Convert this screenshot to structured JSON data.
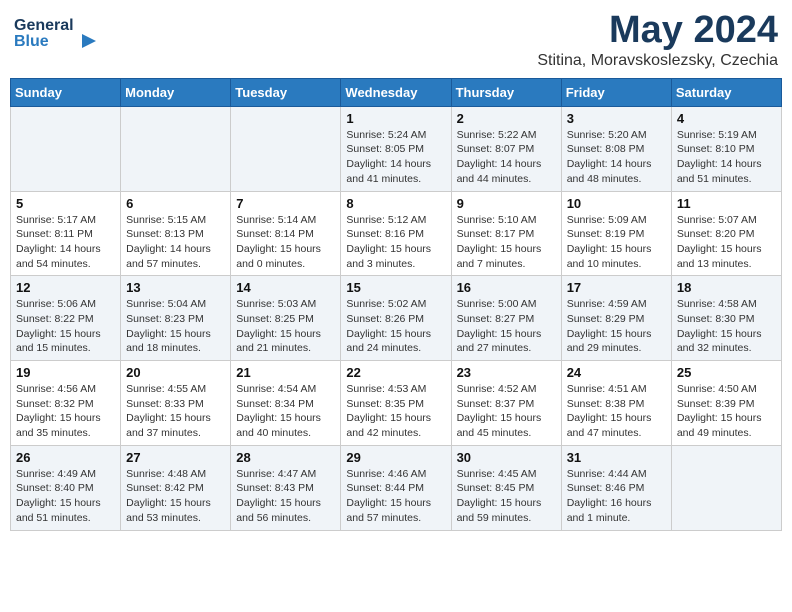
{
  "header": {
    "logo_general": "General",
    "logo_blue": "Blue",
    "title": "May 2024",
    "subtitle": "Stitina, Moravskoslezsky, Czechia"
  },
  "days_of_week": [
    "Sunday",
    "Monday",
    "Tuesday",
    "Wednesday",
    "Thursday",
    "Friday",
    "Saturday"
  ],
  "weeks": [
    [
      {
        "day": "",
        "info": ""
      },
      {
        "day": "",
        "info": ""
      },
      {
        "day": "",
        "info": ""
      },
      {
        "day": "1",
        "info": "Sunrise: 5:24 AM\nSunset: 8:05 PM\nDaylight: 14 hours and 41 minutes."
      },
      {
        "day": "2",
        "info": "Sunrise: 5:22 AM\nSunset: 8:07 PM\nDaylight: 14 hours and 44 minutes."
      },
      {
        "day": "3",
        "info": "Sunrise: 5:20 AM\nSunset: 8:08 PM\nDaylight: 14 hours and 48 minutes."
      },
      {
        "day": "4",
        "info": "Sunrise: 5:19 AM\nSunset: 8:10 PM\nDaylight: 14 hours and 51 minutes."
      }
    ],
    [
      {
        "day": "5",
        "info": "Sunrise: 5:17 AM\nSunset: 8:11 PM\nDaylight: 14 hours and 54 minutes."
      },
      {
        "day": "6",
        "info": "Sunrise: 5:15 AM\nSunset: 8:13 PM\nDaylight: 14 hours and 57 minutes."
      },
      {
        "day": "7",
        "info": "Sunrise: 5:14 AM\nSunset: 8:14 PM\nDaylight: 15 hours and 0 minutes."
      },
      {
        "day": "8",
        "info": "Sunrise: 5:12 AM\nSunset: 8:16 PM\nDaylight: 15 hours and 3 minutes."
      },
      {
        "day": "9",
        "info": "Sunrise: 5:10 AM\nSunset: 8:17 PM\nDaylight: 15 hours and 7 minutes."
      },
      {
        "day": "10",
        "info": "Sunrise: 5:09 AM\nSunset: 8:19 PM\nDaylight: 15 hours and 10 minutes."
      },
      {
        "day": "11",
        "info": "Sunrise: 5:07 AM\nSunset: 8:20 PM\nDaylight: 15 hours and 13 minutes."
      }
    ],
    [
      {
        "day": "12",
        "info": "Sunrise: 5:06 AM\nSunset: 8:22 PM\nDaylight: 15 hours and 15 minutes."
      },
      {
        "day": "13",
        "info": "Sunrise: 5:04 AM\nSunset: 8:23 PM\nDaylight: 15 hours and 18 minutes."
      },
      {
        "day": "14",
        "info": "Sunrise: 5:03 AM\nSunset: 8:25 PM\nDaylight: 15 hours and 21 minutes."
      },
      {
        "day": "15",
        "info": "Sunrise: 5:02 AM\nSunset: 8:26 PM\nDaylight: 15 hours and 24 minutes."
      },
      {
        "day": "16",
        "info": "Sunrise: 5:00 AM\nSunset: 8:27 PM\nDaylight: 15 hours and 27 minutes."
      },
      {
        "day": "17",
        "info": "Sunrise: 4:59 AM\nSunset: 8:29 PM\nDaylight: 15 hours and 29 minutes."
      },
      {
        "day": "18",
        "info": "Sunrise: 4:58 AM\nSunset: 8:30 PM\nDaylight: 15 hours and 32 minutes."
      }
    ],
    [
      {
        "day": "19",
        "info": "Sunrise: 4:56 AM\nSunset: 8:32 PM\nDaylight: 15 hours and 35 minutes."
      },
      {
        "day": "20",
        "info": "Sunrise: 4:55 AM\nSunset: 8:33 PM\nDaylight: 15 hours and 37 minutes."
      },
      {
        "day": "21",
        "info": "Sunrise: 4:54 AM\nSunset: 8:34 PM\nDaylight: 15 hours and 40 minutes."
      },
      {
        "day": "22",
        "info": "Sunrise: 4:53 AM\nSunset: 8:35 PM\nDaylight: 15 hours and 42 minutes."
      },
      {
        "day": "23",
        "info": "Sunrise: 4:52 AM\nSunset: 8:37 PM\nDaylight: 15 hours and 45 minutes."
      },
      {
        "day": "24",
        "info": "Sunrise: 4:51 AM\nSunset: 8:38 PM\nDaylight: 15 hours and 47 minutes."
      },
      {
        "day": "25",
        "info": "Sunrise: 4:50 AM\nSunset: 8:39 PM\nDaylight: 15 hours and 49 minutes."
      }
    ],
    [
      {
        "day": "26",
        "info": "Sunrise: 4:49 AM\nSunset: 8:40 PM\nDaylight: 15 hours and 51 minutes."
      },
      {
        "day": "27",
        "info": "Sunrise: 4:48 AM\nSunset: 8:42 PM\nDaylight: 15 hours and 53 minutes."
      },
      {
        "day": "28",
        "info": "Sunrise: 4:47 AM\nSunset: 8:43 PM\nDaylight: 15 hours and 56 minutes."
      },
      {
        "day": "29",
        "info": "Sunrise: 4:46 AM\nSunset: 8:44 PM\nDaylight: 15 hours and 57 minutes."
      },
      {
        "day": "30",
        "info": "Sunrise: 4:45 AM\nSunset: 8:45 PM\nDaylight: 15 hours and 59 minutes."
      },
      {
        "day": "31",
        "info": "Sunrise: 4:44 AM\nSunset: 8:46 PM\nDaylight: 16 hours and 1 minute."
      },
      {
        "day": "",
        "info": ""
      }
    ]
  ]
}
